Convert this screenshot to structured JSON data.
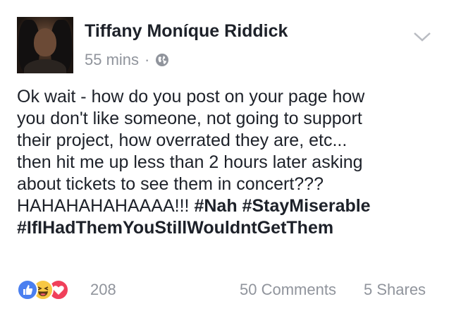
{
  "post": {
    "author": "Tiffany Moníque Riddick",
    "time": "55 mins",
    "separator": "·",
    "privacy_icon": "globe-icon",
    "lines": [
      "Ok wait - how do you post on your page how",
      "you don't like someone, not going to support",
      "their project, how overrated they are, etc...",
      "then hit me up less than 2 hours later asking",
      "about tickets to see them in concert???"
    ],
    "last_line_text": "HAHAHAHAHAAAA!!! ",
    "hashtags": [
      "#Nah",
      "#StayMiserable",
      "#IfIHadThemYouStillWouldntGetThem"
    ]
  },
  "footer": {
    "reactions": [
      "like-icon",
      "haha-icon",
      "love-icon"
    ],
    "reaction_count": "208",
    "comments": "50 Comments",
    "shares": "5 Shares"
  },
  "colors": {
    "text": "#1d2129",
    "meta": "#90949c",
    "like": "#4a7ff0",
    "haha": "#f7c845",
    "love": "#f0405a"
  }
}
